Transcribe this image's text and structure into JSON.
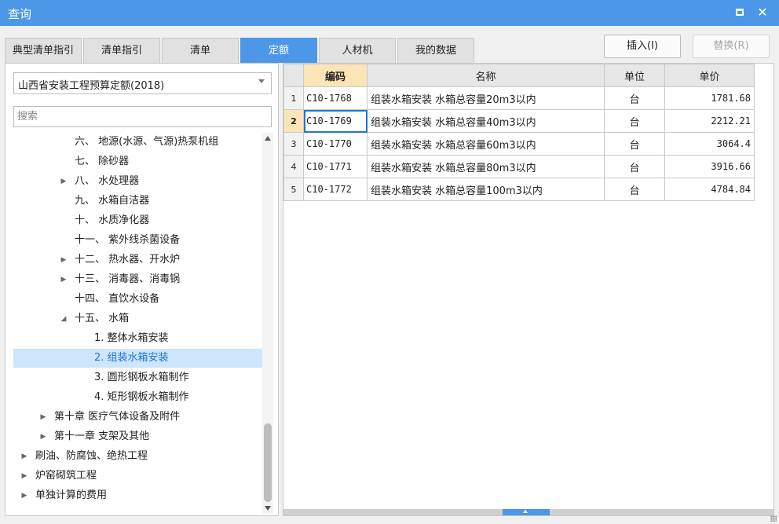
{
  "window": {
    "title": "查询"
  },
  "tabs": [
    {
      "label": "典型清单指引",
      "active": false
    },
    {
      "label": "清单指引",
      "active": false
    },
    {
      "label": "清单",
      "active": false
    },
    {
      "label": "定额",
      "active": true
    },
    {
      "label": "人材机",
      "active": false
    },
    {
      "label": "我的数据",
      "active": false
    }
  ],
  "actions": {
    "insert_label": "插入(I)",
    "replace_label": "替换(R)"
  },
  "library": {
    "selected": "山西省安装工程预算定额(2018)"
  },
  "search": {
    "placeholder": "搜索",
    "value": ""
  },
  "tree": [
    {
      "label": "六、 地源(水源、气源)热泵机组",
      "caret": ""
    },
    {
      "label": "七、 除砂器",
      "caret": ""
    },
    {
      "label": "八、 水处理器",
      "caret": "▶"
    },
    {
      "label": "九、 水箱自洁器",
      "caret": ""
    },
    {
      "label": "十、 水质净化器",
      "caret": ""
    },
    {
      "label": "十一、 紫外线杀菌设备",
      "caret": ""
    },
    {
      "label": "十二、 热水器、开水炉",
      "caret": "▶"
    },
    {
      "label": "十三、 消毒器、消毒锅",
      "caret": "▶"
    },
    {
      "label": "十四、 直饮水设备",
      "caret": ""
    },
    {
      "label": "十五、 水箱",
      "caret": "◢"
    },
    {
      "label": "1. 整体水箱安装",
      "caret": ""
    },
    {
      "label": "2. 组装水箱安装",
      "caret": ""
    },
    {
      "label": "3. 圆形钢板水箱制作",
      "caret": ""
    },
    {
      "label": "4. 矩形钢板水箱制作",
      "caret": ""
    },
    {
      "label": "第十章 医疗气体设备及附件",
      "caret": "▶"
    },
    {
      "label": "第十一章 支架及其他",
      "caret": "▶"
    },
    {
      "label": "刷油、防腐蚀、绝热工程",
      "caret": "▶"
    },
    {
      "label": "炉窑砌筑工程",
      "caret": "▶"
    },
    {
      "label": "单独计算的费用",
      "caret": "▶"
    }
  ],
  "grid": {
    "columns": [
      "编码",
      "名称",
      "单位",
      "单价"
    ],
    "rows": [
      {
        "n": "1",
        "code": "C10-1768",
        "name": "组装水箱安装 水箱总容量20m3以内",
        "unit": "台",
        "price": "1781.68"
      },
      {
        "n": "2",
        "code": "C10-1769",
        "name": "组装水箱安装 水箱总容量40m3以内",
        "unit": "台",
        "price": "2212.21"
      },
      {
        "n": "3",
        "code": "C10-1770",
        "name": "组装水箱安装 水箱总容量60m3以内",
        "unit": "台",
        "price": "3064.4"
      },
      {
        "n": "4",
        "code": "C10-1771",
        "name": "组装水箱安装 水箱总容量80m3以内",
        "unit": "台",
        "price": "3916.66"
      },
      {
        "n": "5",
        "code": "C10-1772",
        "name": "组装水箱安装 水箱总容量100m3以内",
        "unit": "台",
        "price": "4784.84"
      }
    ]
  }
}
